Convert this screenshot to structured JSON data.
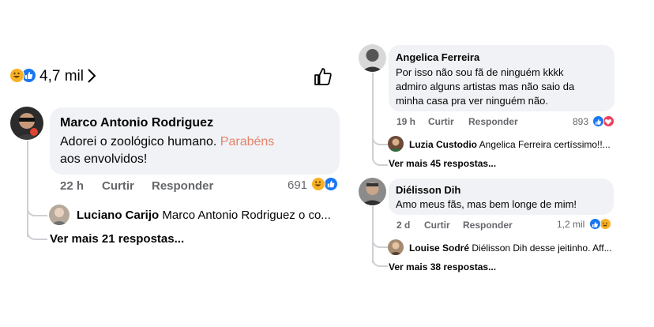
{
  "left": {
    "reaction_total": "4,7 mil",
    "comment": {
      "author": "Marco Antonio Rodriguez",
      "text_part1": "Adorei o zoológico humano. ",
      "text_highlight": "Parabéns",
      "text_part2": "aos envolvidos!",
      "time": "22 h",
      "like_label": "Curtir",
      "reply_label": "Responder",
      "reaction_count": "691"
    },
    "reply": {
      "author": "Luciano Carijo",
      "text": "Marco Antonio Rodriguez o co..."
    },
    "more_replies": "Ver mais 21 respostas..."
  },
  "right": {
    "comment1": {
      "author": "Angelica Ferreira",
      "line1": "Por isso não sou fã de ninguém kkkk",
      "line2": "admiro alguns artistas mas não saio da",
      "line3": "minha casa pra ver ninguém não.",
      "time": "19 h",
      "like_label": "Curtir",
      "reply_label": "Responder",
      "reaction_count": "893",
      "reply": {
        "author": "Luzia Custodio",
        "text": "Angelica Ferreira certíssimo!!..."
      },
      "more_replies": "Ver mais 45 respostas..."
    },
    "comment2": {
      "author": "Diélisson Dih",
      "text": "Amo meus fãs, mas bem longe de mim!",
      "time": "2 d",
      "like_label": "Curtir",
      "reply_label": "Responder",
      "reaction_count": "1,2 mil",
      "reply": {
        "author": "Louise Sodré",
        "text": "Diélisson Dih desse jeitinho. Aff..."
      },
      "more_replies": "Ver mais 38 respostas..."
    }
  },
  "colors": {
    "highlight": "#e4826a",
    "meta": "#65676b",
    "bubble": "#f0f2f5",
    "like": "#1877f2",
    "haha": "#f7b125",
    "love": "#f33e58"
  },
  "icons": [
    "haha-reaction-icon",
    "like-reaction-icon",
    "love-reaction-icon",
    "chevron-right-icon",
    "thumbs-up-icon"
  ]
}
